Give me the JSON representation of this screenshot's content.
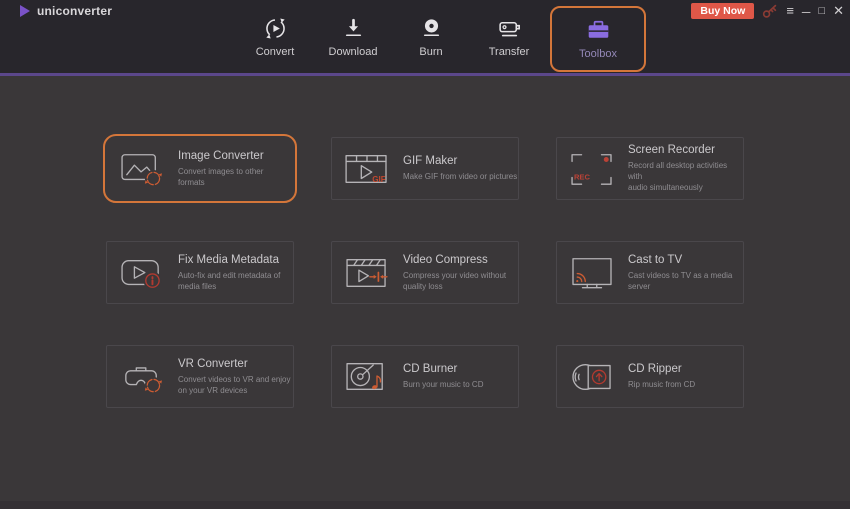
{
  "app": {
    "logo_text": "uniconverter",
    "buy_now_label": "Buy Now"
  },
  "window_controls": {
    "menu_glyph": "≡",
    "minimize_glyph": "─",
    "maximize_glyph": "□",
    "close_glyph": "✕"
  },
  "nav": {
    "tabs": [
      {
        "label": "Convert",
        "icon": "convert-icon",
        "active": false
      },
      {
        "label": "Download",
        "icon": "download-icon",
        "active": false
      },
      {
        "label": "Burn",
        "icon": "burn-icon",
        "active": false
      },
      {
        "label": "Transfer",
        "icon": "transfer-icon",
        "active": false
      },
      {
        "label": "Toolbox",
        "icon": "toolbox-icon",
        "active": true
      }
    ]
  },
  "toolbox": {
    "cards": [
      {
        "title": "Image Converter",
        "desc": "Convert images to other\nformats",
        "icon": "image-converter-icon",
        "highlighted": true
      },
      {
        "title": "GIF Maker",
        "desc": "Make GIF from video or pictures",
        "icon": "gif-maker-icon",
        "icon_label": "GIF",
        "highlighted": false
      },
      {
        "title": "Screen Recorder",
        "desc": "Record all desktop activities with\naudio simultaneously",
        "icon": "screen-recorder-icon",
        "icon_label": "REC",
        "highlighted": false
      },
      {
        "title": "Fix Media Metadata",
        "desc": "Auto-fix and edit metadata of\nmedia files",
        "icon": "fix-metadata-icon",
        "highlighted": false
      },
      {
        "title": "Video Compress",
        "desc": "Compress your video without\nquality loss",
        "icon": "video-compress-icon",
        "highlighted": false
      },
      {
        "title": "Cast to TV",
        "desc": "Cast videos to TV as a media\nserver",
        "icon": "cast-to-tv-icon",
        "highlighted": false
      },
      {
        "title": "VR Converter",
        "desc": "Convert videos to VR and enjoy\non your VR devices",
        "icon": "vr-converter-icon",
        "highlighted": false
      },
      {
        "title": "CD Burner",
        "desc": "Burn your music to CD",
        "icon": "cd-burner-icon",
        "highlighted": false
      },
      {
        "title": "CD Ripper",
        "desc": "Rip music from CD",
        "icon": "cd-ripper-icon",
        "highlighted": false
      }
    ]
  },
  "colors": {
    "topbar": "#28262c",
    "background": "#3a3739",
    "accent_purple_line": "#5b478b",
    "highlight_orange": "#d4763a",
    "buy_now_red": "#df5748",
    "icon_red": "#bb4236",
    "icon_orange": "#cc5c33",
    "toolbox_purple": "#8a6ce0"
  }
}
